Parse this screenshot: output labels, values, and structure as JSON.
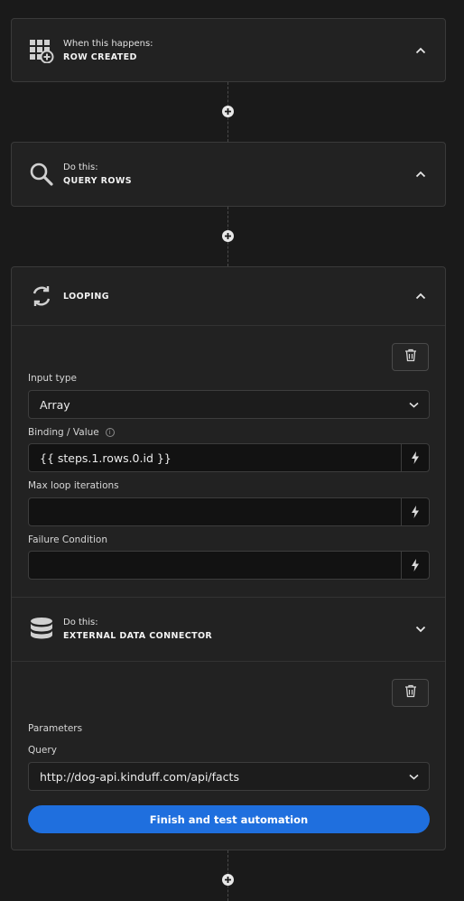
{
  "colors": {
    "background": "#1a1a1a",
    "card": "#222222",
    "accent": "#1f6fde"
  },
  "trigger": {
    "subtitle": "When this happens:",
    "title": "ROW CREATED",
    "icon": "table-add-icon"
  },
  "step1": {
    "subtitle": "Do this:",
    "title": "QUERY ROWS",
    "icon": "search-icon"
  },
  "loop": {
    "title": "LOOPING",
    "icon": "loop-icon",
    "input_type_label": "Input type",
    "input_type_value": "Array",
    "binding_label": "Binding / Value",
    "binding_info": "i",
    "binding_value": "{{ steps.1.rows.0.id }}",
    "max_iter_label": "Max loop iterations",
    "max_iter_value": "",
    "failure_label": "Failure Condition",
    "failure_value": ""
  },
  "connector_step": {
    "subtitle": "Do this:",
    "title": "EXTERNAL DATA CONNECTOR",
    "icon": "database-icon",
    "parameters_label": "Parameters",
    "query_label": "Query",
    "query_value": "http://dog-api.kinduff.com/api/facts",
    "finish_button": "Finish and test automation"
  }
}
